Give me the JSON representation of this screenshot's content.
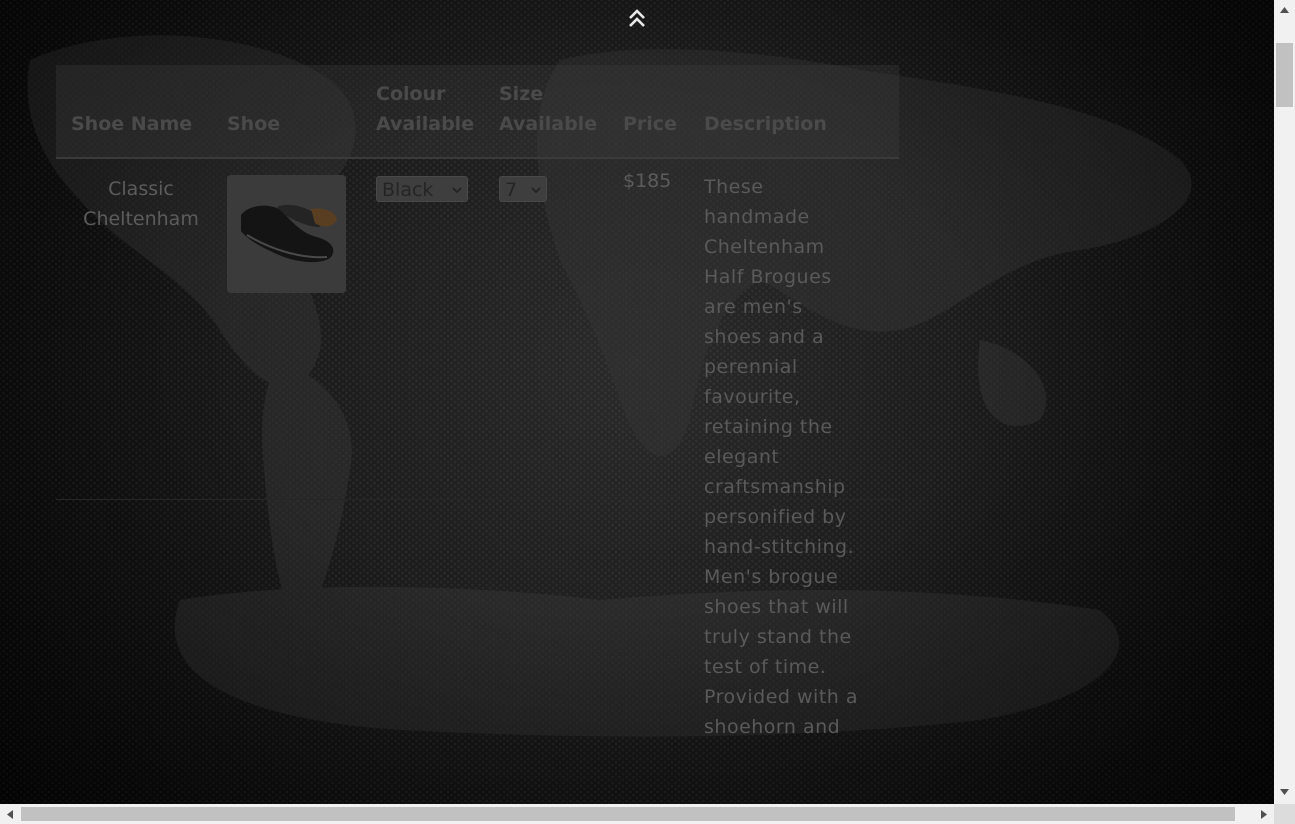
{
  "table": {
    "headers": {
      "name": "Shoe Name",
      "shoe": "Shoe",
      "colour_line1": "Colour",
      "colour_line2": "Available",
      "size_line1": "Size",
      "size_line2": "Available",
      "price": "Price",
      "description": "Description"
    },
    "rows": [
      {
        "name_line1": "Classic",
        "name_line2": "Cheltenham",
        "colour_selected": "Black",
        "size_selected": "7",
        "price": "$185",
        "description": "These handmade Cheltenham Half Brogues are men's shoes and a perennial favourite, retaining the elegant craftsmanship personified by hand-stitching. Men's brogue shoes that will truly stand the test of time. Provided with a shoehorn and"
      }
    ]
  },
  "icons": {
    "back_to_top": "double-chevron-up-icon",
    "dropdown": "chevron-down-icon"
  },
  "colors": {
    "background": "#0d0d0d",
    "text": "#5c5c5c",
    "header_text": "#4a4a4a"
  }
}
